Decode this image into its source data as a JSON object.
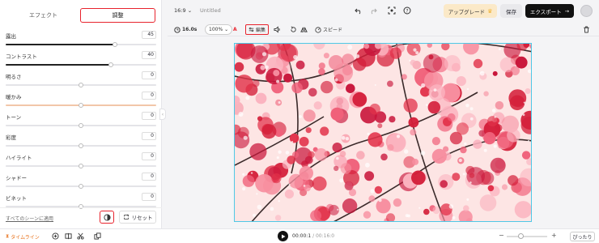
{
  "panel": {
    "tabs": [
      {
        "label": "エフェクト",
        "active": false
      },
      {
        "label": "調整",
        "active": true
      }
    ],
    "sliders": [
      {
        "label": "露出",
        "value": "45",
        "level": 0.725
      },
      {
        "label": "コントラスト",
        "value": "40",
        "level": 0.7
      },
      {
        "label": "明るさ",
        "value": "0",
        "level": 0.5
      },
      {
        "label": "暖かみ",
        "value": "0",
        "level": 0.5
      },
      {
        "label": "トーン",
        "value": "0",
        "level": 0.5
      },
      {
        "label": "彩度",
        "value": "0",
        "level": 0.5
      },
      {
        "label": "ハイライト",
        "value": "0",
        "level": 0.5
      },
      {
        "label": "シャドー",
        "value": "0",
        "level": 0.5
      },
      {
        "label": "ビネット",
        "value": "0",
        "level": 0.5
      }
    ],
    "apply_all": "すべてのシーンに適用",
    "compare_tooltip": "比較",
    "reset_label": "リセット"
  },
  "topbar": {
    "ratio": "16:9",
    "title": "Untitled",
    "upgrade": "アップグレード",
    "save": "保存",
    "export": "エクスポート"
  },
  "toolbar": {
    "duration": "16.0s",
    "zoom": "100%",
    "edit": "編集",
    "speed": "スピード"
  },
  "bottom": {
    "timeline": "タイムライン",
    "current_time": "00:00:1",
    "total_time": "/ 00:16:0",
    "fit": "ぴったり"
  },
  "colors": {
    "accent_red": "#e8232d",
    "canvas_border": "#4fc8e6",
    "export_bg": "#111111",
    "upgrade_bg": "#fbe9c8"
  }
}
